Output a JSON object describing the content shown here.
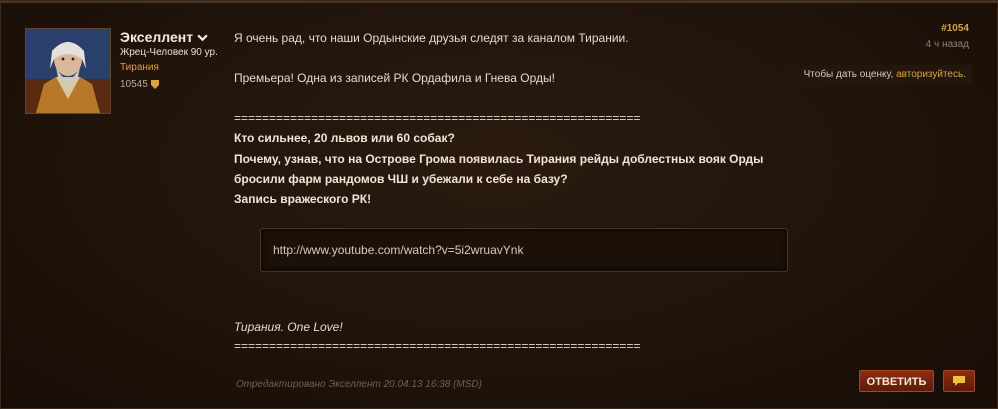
{
  "author": {
    "name": "Экселлент",
    "class_line": "Жрец-Человек 90 ур.",
    "realm": "Тирания",
    "points": "10545"
  },
  "post": {
    "number": "#1054",
    "time": "4 ч назад",
    "lines": [
      "Я очень рад, что наши Ордынские друзья следят за каналом Тирании.",
      "Премьера! Одна из записей РК Ордафила и Гнева Орды!",
      "==========================================================",
      "Кто сильнее, 20 львов или 60 собак?",
      "Почему, узнав, что на Острове Грома появилась Тирания рейды доблестных вояк Орды",
      "бросили фарм рандомов ЧШ и убежали к себе на базу?",
      "Запись вражеского РК!",
      "Тирания. One Love!",
      "=========================================================="
    ],
    "video_url": "http://www.youtube.com/watch?v=5i2wruavYnk",
    "edited": "Отредактировано Экселлент 20.04.13 16:38 (MSD)"
  },
  "rating": {
    "text": "Чтобы дать оценку,",
    "link": "авторизуйтесь."
  },
  "actions": {
    "reply_label": "ОТВЕТИТЬ"
  },
  "icons": {
    "quote": "speech-bubble-icon",
    "chevron": "chevron-down-icon",
    "points": "shield-icon"
  },
  "colors": {
    "accent": "#d9a43e",
    "button": "#8a2d12"
  }
}
